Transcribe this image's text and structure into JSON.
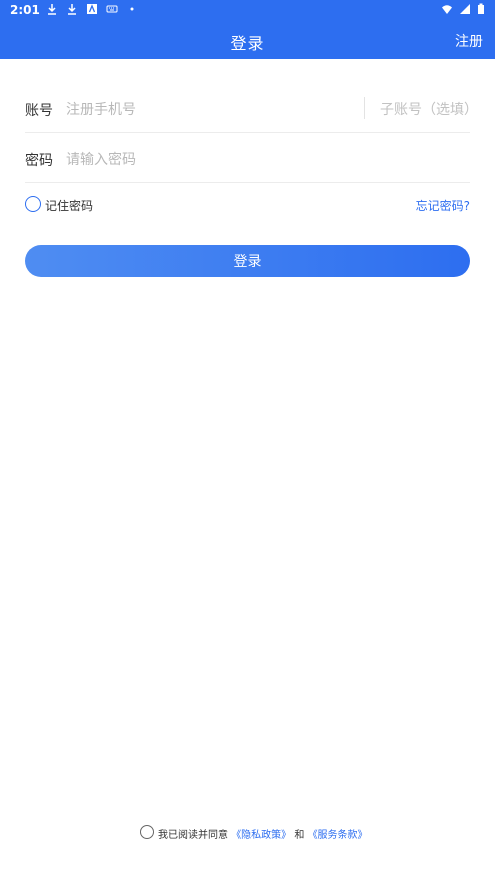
{
  "status": {
    "time": "2:01"
  },
  "header": {
    "title": "登录",
    "action": "注册"
  },
  "form": {
    "account_label": "账号",
    "account_placeholder": "注册手机号",
    "sub_account_placeholder": "子账号（选填）",
    "password_label": "密码",
    "password_placeholder": "请输入密码",
    "remember_label": "记住密码",
    "forgot_label": "忘记密码?",
    "login_label": "登录"
  },
  "footer": {
    "agree_prefix": "我已阅读并同意",
    "privacy_link": "《隐私政策》",
    "and": "和",
    "service_link": "《服务条款》"
  },
  "colors": {
    "primary": "#2d6ef0"
  }
}
